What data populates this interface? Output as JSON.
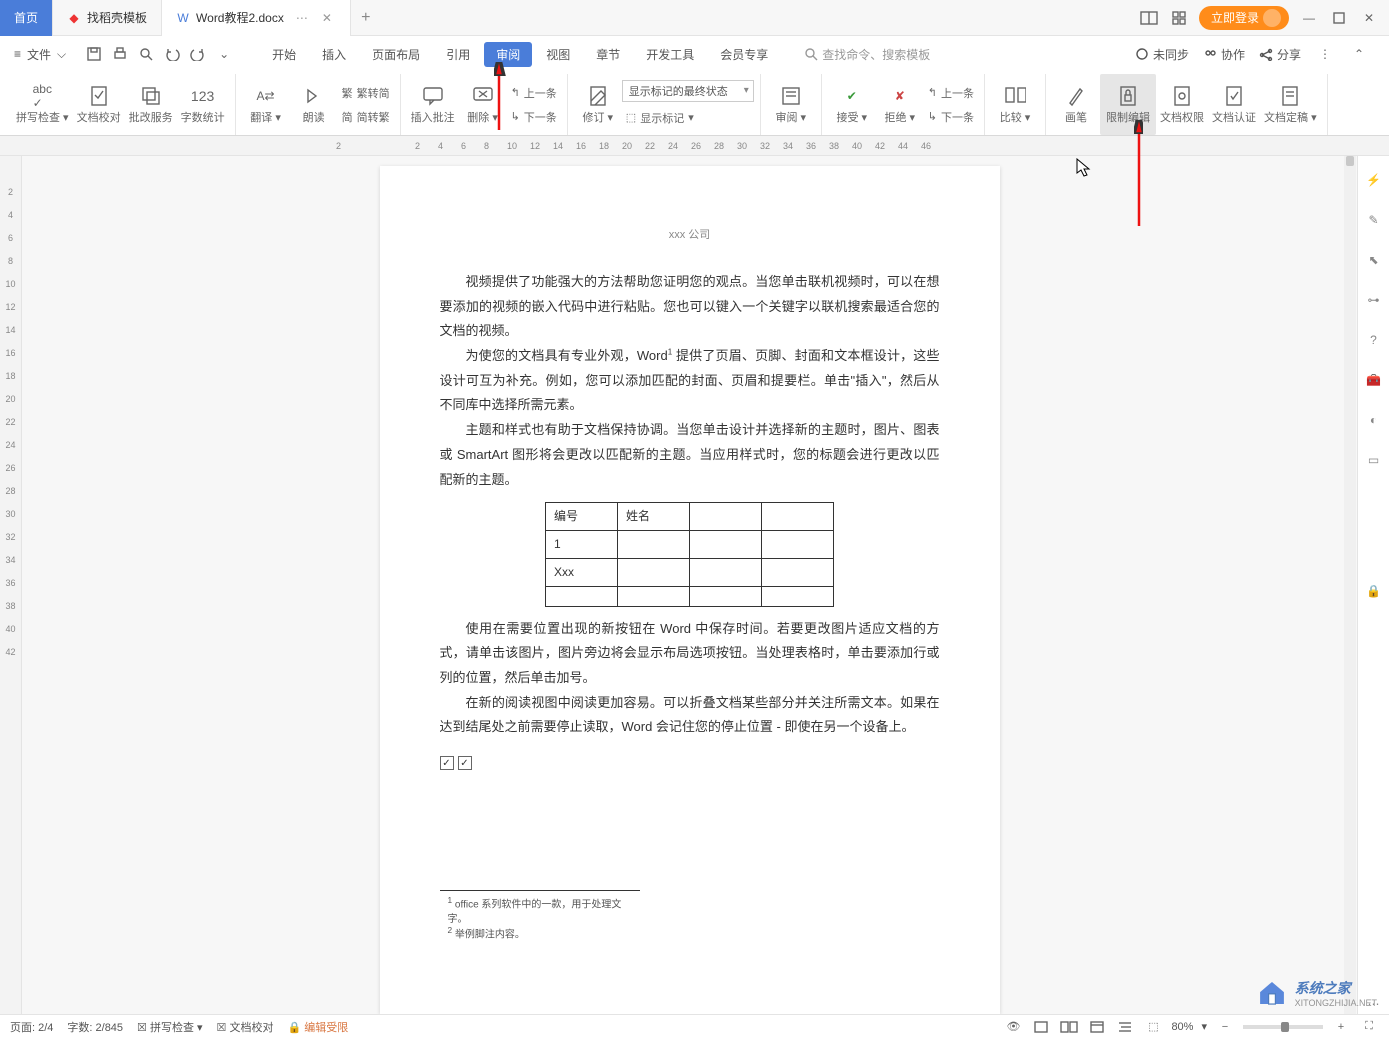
{
  "tabs": {
    "home": "首页",
    "template": "找稻壳模板",
    "doc": "Word教程2.docx"
  },
  "titlebar": {
    "login": "立即登录"
  },
  "menu": {
    "file": "文件",
    "tabs": [
      "开始",
      "插入",
      "页面布局",
      "引用",
      "审阅",
      "视图",
      "章节",
      "开发工具",
      "会员专享"
    ],
    "active_index": 4,
    "search_placeholder": "查找命令、搜索模板",
    "right": {
      "unsync": "未同步",
      "collab": "协作",
      "share": "分享"
    }
  },
  "ribbon": {
    "spellcheck": "拼写检查",
    "docproof": "文档校对",
    "batch": "批改服务",
    "wordcount": "字数统计",
    "translate": "翻译",
    "read": "朗读",
    "sim2trad": "简转繁",
    "trad2sim": "简转繁",
    "trad_top": "繁转简",
    "insert_comment": "插入批注",
    "delete": "删除",
    "prev": "上一条",
    "next": "下一条",
    "track": "修订",
    "combo": "显示标记的最终状态",
    "show_marks": "显示标记",
    "review": "审阅",
    "accept": "接受",
    "reject": "拒绝",
    "prev2": "上一条",
    "next2": "下一条",
    "compare": "比较",
    "brush": "画笔",
    "restrict": "限制编辑",
    "docperm": "文档权限",
    "docauth": "文档认证",
    "docfinal": "文档定稿"
  },
  "ruler_h": [
    "2",
    "",
    "2",
    "4",
    "6",
    "8",
    "10",
    "12",
    "14",
    "16",
    "18",
    "20",
    "22",
    "24",
    "26",
    "28",
    "30",
    "32",
    "34",
    "36",
    "38",
    "40",
    "42",
    "44",
    "46"
  ],
  "ruler_v": [
    "",
    "2",
    "4",
    "6",
    "8",
    "10",
    "12",
    "14",
    "16",
    "18",
    "20",
    "22",
    "24",
    "26",
    "28",
    "30",
    "32",
    "34",
    "36",
    "38",
    "40",
    "42"
  ],
  "doc": {
    "header": "xxx 公司",
    "p1": "视频提供了功能强大的方法帮助您证明您的观点。当您单击联机视频时，可以在想要添加的视频的嵌入代码中进行粘贴。您也可以键入一个关键字以联机搜索最适合您的文档的视频。",
    "p2a": "为使您的文档具有专业外观，Word",
    "p2b": " 提供了页眉、页脚、封面和文本框设计，这些设计可互为补充。例如，您可以添加匹配的封面、页眉和提要栏。单击\"插入\"，然后从不同库中选择所需元素。",
    "p3": "主题和样式也有助于文档保持协调。当您单击设计并选择新的主题时，图片、图表或 SmartArt 图形将会更改以匹配新的主题。当应用样式时，您的标题会进行更改以匹配新的主题。",
    "table": {
      "h1": "编号",
      "h2": "姓名",
      "r1": "1",
      "r2": "Xxx"
    },
    "p4": "使用在需要位置出现的新按钮在 Word 中保存时间。若要更改图片适应文档的方式，请单击该图片，图片旁边将会显示布局选项按钮。当处理表格时，单击要添加行或列的位置，然后单击加号。",
    "p5": "在新的阅读视图中阅读更加容易。可以折叠文档某些部分并关注所需文本。如果在达到结尾处之前需要停止读取，Word 会记住您的停止位置 - 即使在另一个设备上。",
    "fn1": "office 系列软件中的一款，用于处理文字。",
    "fn2": "举例脚注内容。"
  },
  "status": {
    "page": "页面: 2/4",
    "words": "字数: 2/845",
    "spell": "拼写检查",
    "proof": "文档校对",
    "restrict": "编辑受限",
    "zoom": "80%"
  },
  "watermark": {
    "title": "系统之家",
    "sub": "XITONGZHIJIA.NET"
  }
}
